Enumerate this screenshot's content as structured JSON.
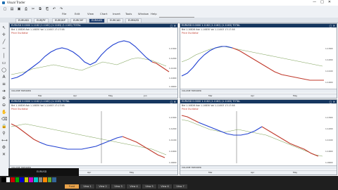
{
  "app": {
    "title": "Visual Trader"
  },
  "menu": [
    "File",
    "Edit",
    "View",
    "Chart",
    "Insert",
    "Tools",
    "Window",
    "Help"
  ],
  "toolbar": {
    "search_value": "EURUSD",
    "icons": [
      "new-icon",
      "open-icon",
      "save-icon",
      "print-icon",
      "cut-icon",
      "copy-icon",
      "paste-icon",
      "undo-icon",
      "redo-icon"
    ]
  },
  "tabs": [
    "EURUSD",
    "EURJPY",
    "EURGBP",
    "EURCHF",
    "EURAUD",
    "EURCAD",
    "EURNZD"
  ],
  "active_tab_index": 4,
  "charts": [
    {
      "header": "EURUSD 0.0000 1.1162 (1.1162) (1.1163) (1.1163) TOTAL",
      "sub": "Bid 1.10826 Ask 1.10830 Vol 1.11003 17:17:58",
      "indicator": "Price Oscillator",
      "volume": "VOLUME TRENDER",
      "y_ticks": [
        "1.1300",
        "1.1200",
        "1.1100",
        "1.1000",
        "1.0900"
      ],
      "x_ticks": [
        "Mar",
        "Apr",
        "May",
        "Jun"
      ]
    },
    {
      "header": "EURUSD 0.0000 1.1162 (1.1162) (1.1163) TOTAL",
      "sub": "Bid 1.10826 Ask 1.10830 Vol 1.11003 17:17:58",
      "indicator": "Price Oscillator",
      "volume": "VOLUME TRENDER",
      "y_ticks": [
        "1.1300",
        "1.1200",
        "1.1100",
        "1.1000"
      ],
      "x_ticks": [
        "Mar",
        "Apr",
        "May"
      ]
    },
    {
      "header": "EURUSD 0.0000 1.1162 (1.1162) (1.1163) TOTAL",
      "sub": "Bid 1.10826 Ask 1.10830 Vol 1.11003 17:17:58",
      "indicator": "Price Oscillator",
      "volume": "VOLUME TRENDER",
      "y_ticks": [
        "1.1300",
        "1.1200",
        "1.1100",
        "1.1000",
        "1.0900"
      ],
      "x_ticks": [
        "Mar",
        "Apr",
        "May"
      ]
    },
    {
      "header": "EURUSD 0.0000 1.1162 (1.1162) (1.1163) TOTAL",
      "sub": "Bid 1.10826 Ask 1.10830 Vol 1.11003 17:17:58",
      "indicator": "Price Oscillator",
      "volume": "VOLUME TRENDER",
      "y_ticks": [
        "1.1300",
        "1.1200",
        "1.1100",
        "1.1000",
        "1.0900"
      ],
      "x_ticks": [
        "Mar",
        "Apr",
        "May"
      ]
    }
  ],
  "colors": {
    "header": "#15365f",
    "blue_line": "#1f3fd1",
    "red_line": "#c0392b",
    "price": "#7fa35a"
  },
  "bottom_tabs": [
    "Fund",
    "View 1",
    "View 2",
    "View 3",
    "View 4",
    "View 5",
    "View 6",
    "View 7"
  ],
  "active_bottom_tab": 0,
  "dark_strip_label": "EURUSD"
}
